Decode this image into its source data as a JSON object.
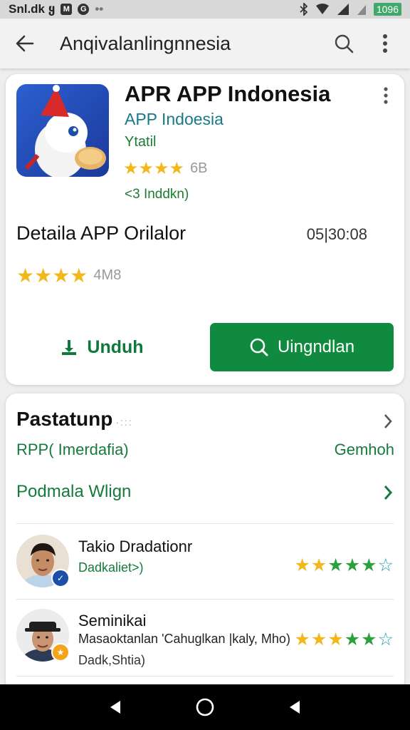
{
  "status_bar": {
    "left_text": "Snl.dk ყ",
    "icon_a": "M",
    "icon_b": "G",
    "dots": "••",
    "battery": "1096"
  },
  "app_bar": {
    "title": "Anqivalanlingnnesia"
  },
  "app": {
    "title": "APR APP Indonesia",
    "developer": "APP Indoesia",
    "tag": "Ytatil",
    "stars": "★★★★",
    "rating_value": "6B",
    "installs": "<3 Inddkn)"
  },
  "details": {
    "title": "Detaila APP Orilalor",
    "time": "05|30:08",
    "stars": "★★★★",
    "rating_value": "4M8"
  },
  "buttons": {
    "download_label": "Unduh",
    "primary_label": "Uingndlan"
  },
  "section": {
    "title": "Pastatunp",
    "title_dots": "·:::",
    "sub_left": "RPP( Imerdafia)",
    "sub_right": "Gemhoh",
    "promo": "Podmala Wlign"
  },
  "reviews": [
    {
      "name": "Takio Dradationr",
      "subtitle": "Dadkaliet>)",
      "stars_yellow": "★★",
      "stars_green": "★★★",
      "stars_empty": "☆"
    },
    {
      "name": "Seminikai",
      "text": "Masaoktanlan 'Cahuglkan |kaly, Mho)",
      "subtitle": "Dadk,Shtia)",
      "stars_yellow": "★★★",
      "stars_green": "★★",
      "stars_empty": "☆"
    }
  ],
  "colors": {
    "accent_green": "#0f8a3e",
    "text_green": "#157a3c",
    "developer_teal": "#157a8a",
    "star_yellow": "#f2b81b"
  },
  "icons": {
    "back": "arrow-left-icon",
    "search": "search-icon",
    "more": "more-vert-icon",
    "download": "download-icon",
    "chevron": "chevron-right-icon"
  }
}
